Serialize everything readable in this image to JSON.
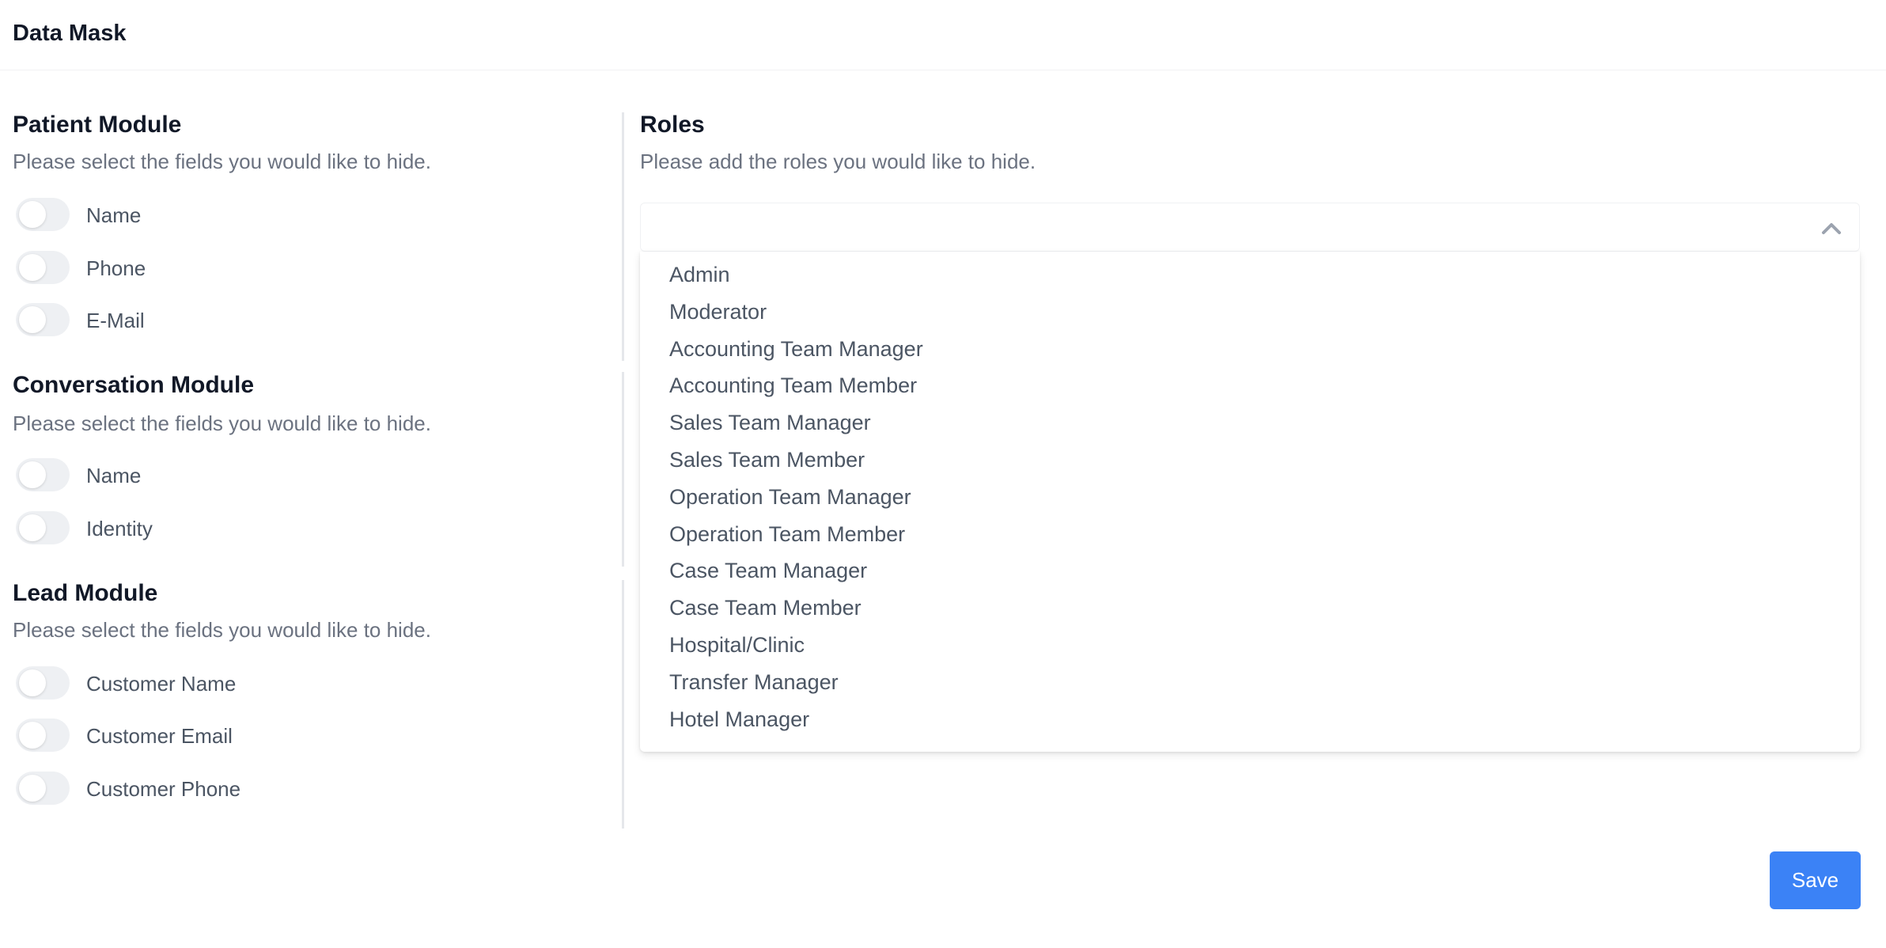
{
  "page": {
    "title": "Data Mask"
  },
  "patient_module": {
    "title": "Patient Module",
    "description": "Please select the fields you would like to hide.",
    "fields": [
      "Name",
      "Phone",
      "E-Mail"
    ]
  },
  "conversation_module": {
    "title": "Conversation Module",
    "description": "Please select the fields you would like to hide.",
    "fields": [
      "Name",
      "Identity"
    ]
  },
  "lead_module": {
    "title": "Lead Module",
    "description": "Please select the fields you would like to hide.",
    "fields": [
      "Customer Name",
      "Customer Email",
      "Customer Phone"
    ]
  },
  "roles": {
    "title": "Roles",
    "description": "Please add the roles you would like to hide.",
    "options": [
      "Admin",
      "Moderator",
      "Accounting Team Manager",
      "Accounting Team Member",
      "Sales Team Manager",
      "Sales Team Member",
      "Operation Team Manager",
      "Operation Team Member",
      "Case Team Manager",
      "Case Team Member",
      "Hospital/Clinic",
      "Transfer Manager",
      "Hotel Manager"
    ]
  },
  "actions": {
    "save_label": "Save"
  },
  "colors": {
    "primary": "#3b82f6",
    "toggle_off": "#eef0f3",
    "muted_text": "#6b7280"
  }
}
